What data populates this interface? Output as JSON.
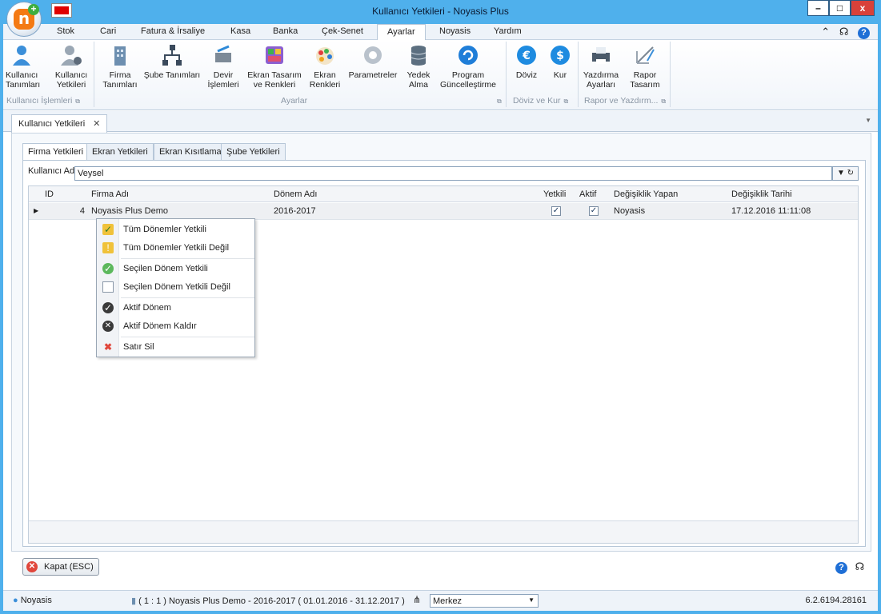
{
  "window": {
    "title": "Kullanıcı Yetkileri - Noyasis Plus",
    "minimize": "–",
    "maximize": "□",
    "close": "x"
  },
  "menu": {
    "tabs": [
      "Stok",
      "Cari",
      "Fatura & İrsaliye",
      "Kasa",
      "Banka",
      "Çek-Senet",
      "Ayarlar",
      "Noyasis",
      "Yardım"
    ],
    "active": "Ayarlar"
  },
  "ribbon": {
    "items": [
      {
        "line1": "Kullanıcı",
        "line2": "Tanımları"
      },
      {
        "line1": "Kullanıcı",
        "line2": "Yetkileri"
      },
      {
        "line1": "Firma",
        "line2": "Tanımları"
      },
      {
        "line1": "Şube Tanımları",
        "line2": ""
      },
      {
        "line1": "Devir",
        "line2": "İşlemleri"
      },
      {
        "line1": "Ekran Tasarım",
        "line2": "ve Renkleri"
      },
      {
        "line1": "Ekran",
        "line2": "Renkleri"
      },
      {
        "line1": "Parametreler",
        "line2": ""
      },
      {
        "line1": "Yedek",
        "line2": "Alma"
      },
      {
        "line1": "Program",
        "line2": "Güncelleştirme"
      },
      {
        "line1": "Döviz",
        "line2": ""
      },
      {
        "line1": "Kur",
        "line2": ""
      },
      {
        "line1": "Yazdırma",
        "line2": "Ayarları"
      },
      {
        "line1": "Rapor",
        "line2": "Tasarım"
      }
    ],
    "groups": {
      "kullanici": "Kullanıcı İşlemleri",
      "ayarlar": "Ayarlar",
      "doviz": "Döviz ve Kur",
      "rapor": "Rapor ve Yazdırm..."
    }
  },
  "doc_tab": {
    "label": "Kullanıcı Yetkileri",
    "close": "✕"
  },
  "inner_tabs": [
    "Firma Yetkileri",
    "Ekran Yetkileri",
    "Ekran Kısıtlama",
    "Şube Yetkileri"
  ],
  "user_field": {
    "label": "Kullanıcı Adı",
    "value": "Veysel"
  },
  "grid": {
    "columns": [
      "ID",
      "Firma Adı",
      "Dönem Adı",
      "Yetkili",
      "Aktif",
      "Değişiklik Yapan",
      "Değişiklik Tarihi"
    ],
    "rows": [
      {
        "id": "4",
        "firma": "Noyasis Plus Demo",
        "donem": "2016-2017",
        "yetkili": true,
        "aktif": true,
        "yapan": "Noyasis",
        "tarih": "17.12.2016 11:11:08"
      }
    ]
  },
  "context_menu": {
    "items": [
      {
        "label": "Tüm Dönemler Yetkili",
        "icon": "clipboard-check-icon"
      },
      {
        "label": "Tüm Dönemler Yetkili Değil",
        "icon": "clipboard-x-icon"
      },
      {
        "label": "Seçilen Dönem Yetkili",
        "icon": "green-check-icon"
      },
      {
        "label": "Seçilen Dönem Yetkili Değil",
        "icon": "blank-page-icon"
      },
      {
        "label": "Aktif Dönem",
        "icon": "dark-check-icon"
      },
      {
        "label": "Aktif Dönem Kaldır",
        "icon": "dark-x-icon"
      },
      {
        "label": "Satır Sil",
        "icon": "red-x-icon"
      }
    ]
  },
  "footer": {
    "close_label": "Kapat (ESC)"
  },
  "status": {
    "user": "Noyasis",
    "info": "( 1 : 1 )  Noyasis Plus Demo - 2016-2017  ( 01.01.2016 - 31.12.2017 )",
    "branch": "Merkez",
    "version": "6.2.6194.28161"
  }
}
